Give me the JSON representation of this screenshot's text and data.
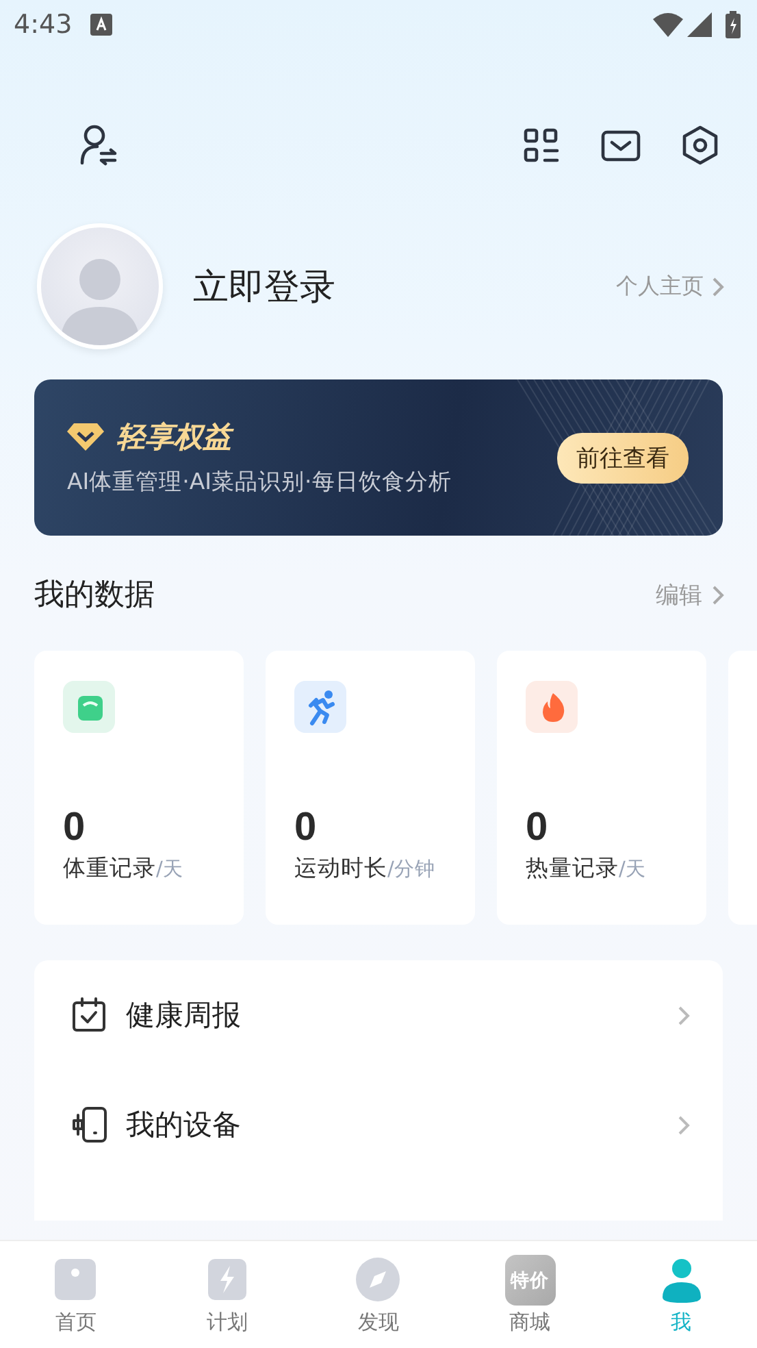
{
  "status_bar": {
    "time": "4:43"
  },
  "profile": {
    "name": "立即登录",
    "link": "个人主页"
  },
  "banner": {
    "title": "轻享权益",
    "subtitle": "AI体重管理·AI菜品识别·每日饮食分析",
    "button": "前往查看"
  },
  "my_data": {
    "title": "我的数据",
    "edit": "编辑",
    "cards": [
      {
        "kind": "scale",
        "value": "0",
        "label": "体重记录",
        "unit": "/天"
      },
      {
        "kind": "run",
        "value": "0",
        "label": "运动时长",
        "unit": "/分钟"
      },
      {
        "kind": "flame",
        "value": "0",
        "label": "热量记录",
        "unit": "/天"
      }
    ]
  },
  "menu": [
    {
      "kind": "calendar",
      "label": "健康周报"
    },
    {
      "kind": "device",
      "label": "我的设备"
    }
  ],
  "tabs": [
    {
      "kind": "home",
      "label": "首页",
      "selected": false
    },
    {
      "kind": "plan",
      "label": "计划",
      "selected": false
    },
    {
      "kind": "discover",
      "label": "发现",
      "selected": false
    },
    {
      "kind": "shop",
      "label": "商城",
      "badge_text": "特价",
      "selected": false
    },
    {
      "kind": "me",
      "label": "我",
      "selected": true
    }
  ]
}
